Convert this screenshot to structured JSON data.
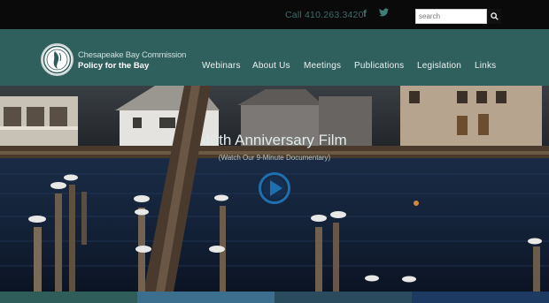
{
  "topbar": {
    "phone": "Call 410.263.3420",
    "search_placeholder": "search",
    "icons": [
      "facebook-icon",
      "twitter-icon",
      "search-icon"
    ]
  },
  "header": {
    "org_line1": "Chesapeake Bay Commission",
    "org_line2": "Policy for the Bay"
  },
  "nav": {
    "items": [
      "Webinars",
      "About Us",
      "Meetings",
      "Publications",
      "Legislation",
      "Links"
    ]
  },
  "hero": {
    "title": "40th Anniversary Film",
    "subtitle": "(Watch Our 9-Minute Documentary)"
  },
  "colors": {
    "topbar": "#0a0a0a",
    "navbar": "#30605e",
    "accent": "#3f7e79",
    "play": "#1e6fb0",
    "strips": [
      "#2e5d5a",
      "#3c6f8d",
      "#2a4a5d",
      "#1d3a63"
    ]
  }
}
